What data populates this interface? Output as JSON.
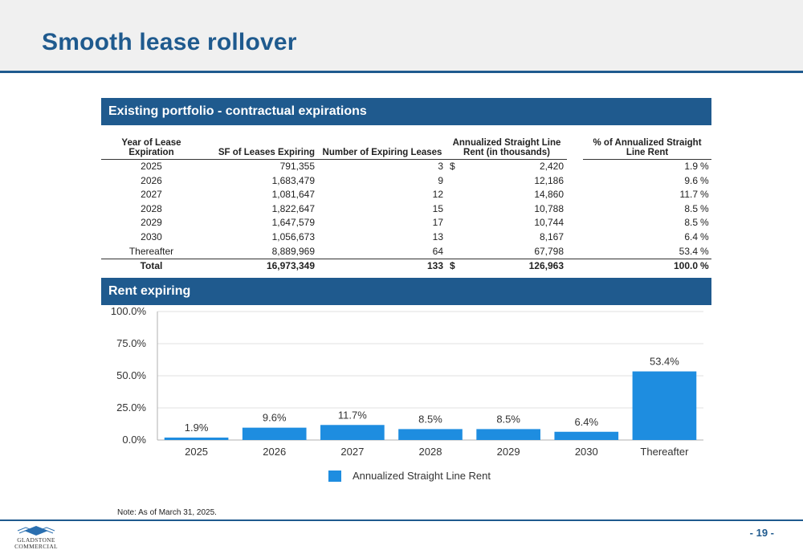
{
  "page": {
    "title": "Smooth lease rollover",
    "note": "Note: As of March 31, 2025.",
    "page_number": "- 19 -",
    "logo_line1": "GLADSTONE",
    "logo_line2": "COMMERCIAL"
  },
  "colors": {
    "brand": "#1f5a8e",
    "bar": "#1e8de0",
    "header_bg": "#f0f0f0"
  },
  "sections": {
    "table_title": "Existing portfolio - contractual expirations",
    "chart_title": "Rent expiring"
  },
  "table": {
    "headers": {
      "year": "Year of Lease Expiration",
      "sf": "SF of Leases Expiring",
      "num": "Number of Expiring Leases",
      "rent": "Annualized Straight Line Rent (in thousands)",
      "pct": "% of Annualized Straight Line Rent"
    },
    "rows": [
      {
        "year": "2025",
        "sf": "791,355",
        "num": "3",
        "dollar": "$",
        "rent": "2,420",
        "pct": "1.9",
        "pct_unit": "%"
      },
      {
        "year": "2026",
        "sf": "1,683,479",
        "num": "9",
        "dollar": "",
        "rent": "12,186",
        "pct": "9.6",
        "pct_unit": "%"
      },
      {
        "year": "2027",
        "sf": "1,081,647",
        "num": "12",
        "dollar": "",
        "rent": "14,860",
        "pct": "11.7",
        "pct_unit": "%"
      },
      {
        "year": "2028",
        "sf": "1,822,647",
        "num": "15",
        "dollar": "",
        "rent": "10,788",
        "pct": "8.5",
        "pct_unit": "%"
      },
      {
        "year": "2029",
        "sf": "1,647,579",
        "num": "17",
        "dollar": "",
        "rent": "10,744",
        "pct": "8.5",
        "pct_unit": "%"
      },
      {
        "year": "2030",
        "sf": "1,056,673",
        "num": "13",
        "dollar": "",
        "rent": "8,167",
        "pct": "6.4",
        "pct_unit": "%"
      },
      {
        "year": "Thereafter",
        "sf": "8,889,969",
        "num": "64",
        "dollar": "",
        "rent": "67,798",
        "pct": "53.4",
        "pct_unit": "%"
      }
    ],
    "total": {
      "year": "Total",
      "sf": "16,973,349",
      "num": "133",
      "dollar": "$",
      "rent": "126,963",
      "pct": "100.0",
      "pct_unit": "%"
    }
  },
  "chart_data": {
    "type": "bar",
    "categories": [
      "2025",
      "2026",
      "2027",
      "2028",
      "2029",
      "2030",
      "Thereafter"
    ],
    "series": [
      {
        "name": "Annualized Straight Line Rent",
        "values": [
          1.9,
          9.6,
          11.7,
          8.5,
          8.5,
          6.4,
          53.4
        ]
      }
    ],
    "data_labels": [
      "1.9%",
      "9.6%",
      "11.7%",
      "8.5%",
      "8.5%",
      "6.4%",
      "53.4%"
    ],
    "y_ticks": [
      "0.0%",
      "25.0%",
      "50.0%",
      "75.0%",
      "100.0%"
    ],
    "y_tick_values": [
      0,
      25,
      50,
      75,
      100
    ],
    "ylim": [
      0,
      100
    ],
    "title": "",
    "xlabel": "",
    "ylabel": "",
    "grid": true,
    "legend_position": "bottom"
  }
}
